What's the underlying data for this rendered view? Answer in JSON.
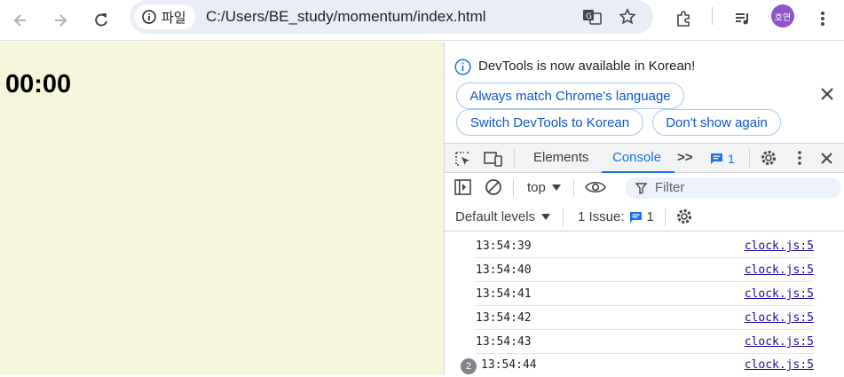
{
  "browser": {
    "site_chip_label": "파일",
    "url": "C:/Users/BE_study/momentum/index.html",
    "avatar_text": "호연"
  },
  "page": {
    "clock": "00:00"
  },
  "devtools": {
    "info_message": "DevTools is now available in Korean!",
    "btn_always_match": "Always match Chrome's language",
    "btn_switch_korean": "Switch DevTools to Korean",
    "btn_dont_show": "Don't show again",
    "tabs": {
      "elements": "Elements",
      "console": "Console",
      "more": ">>",
      "messages_count": "1"
    },
    "console_toolbar": {
      "context": "top",
      "filter_placeholder": "Filter",
      "levels": "Default levels",
      "issues_label": "1 Issue:",
      "issues_count": "1"
    },
    "logs": [
      {
        "msg": "13:54:39",
        "src": "clock.js:5"
      },
      {
        "msg": "13:54:40",
        "src": "clock.js:5"
      },
      {
        "msg": "13:54:41",
        "src": "clock.js:5"
      },
      {
        "msg": "13:54:42",
        "src": "clock.js:5"
      },
      {
        "msg": "13:54:43",
        "src": "clock.js:5"
      },
      {
        "msg": "13:54:44",
        "src": "clock.js:5",
        "repeat": "2"
      }
    ]
  },
  "colors": {
    "page_bg": "#f5f5dc",
    "accent": "#1a73e8"
  }
}
